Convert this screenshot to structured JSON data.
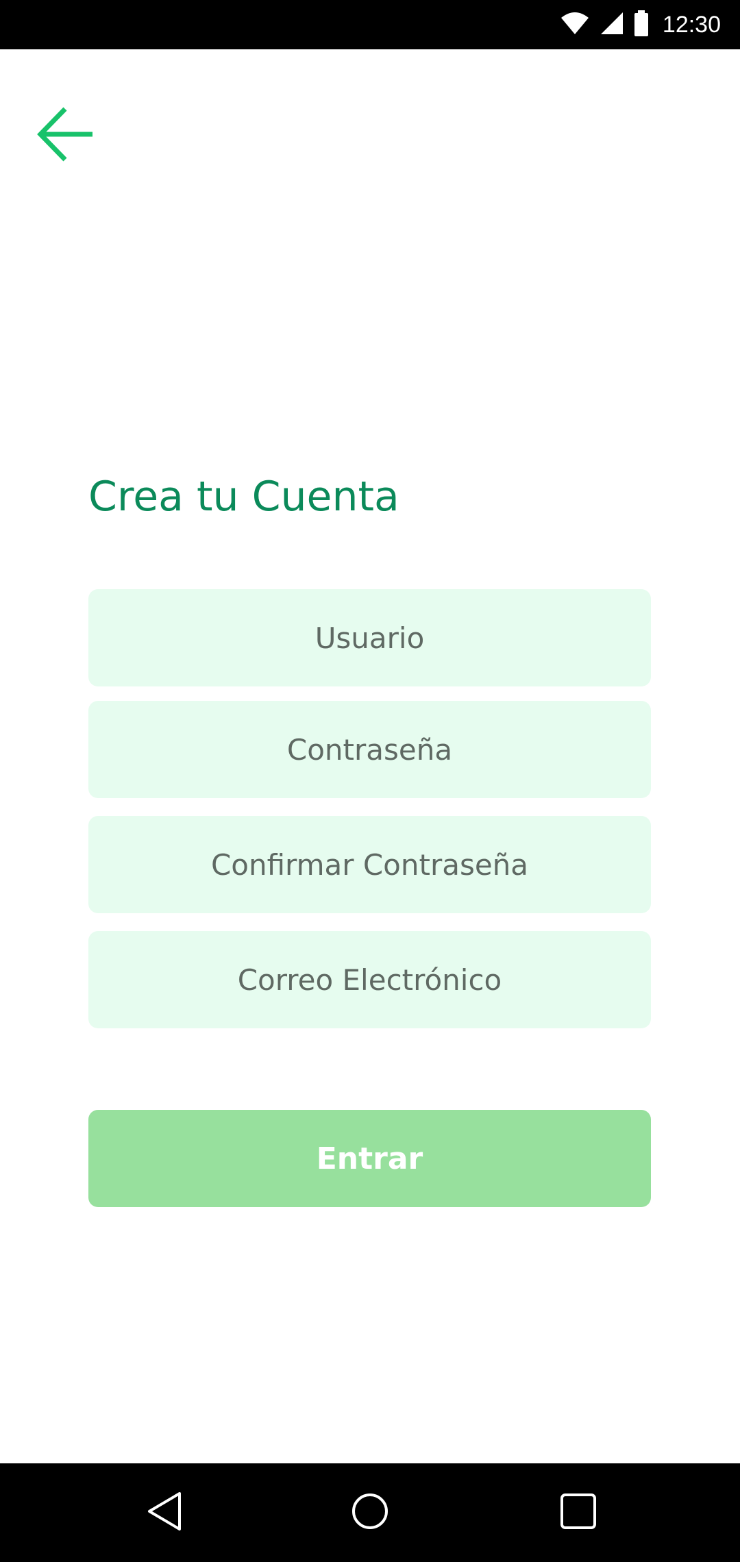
{
  "status_bar": {
    "time": "12:30",
    "icons": [
      "wifi-icon",
      "cellular-signal-icon",
      "battery-icon"
    ]
  },
  "header": {
    "back_icon": "arrow-left-icon",
    "accent_color": "#18c26a"
  },
  "form": {
    "title": "Crea tu Cuenta",
    "fields": [
      {
        "placeholder": "Usuario",
        "value": ""
      },
      {
        "placeholder": "Contraseña",
        "value": ""
      },
      {
        "placeholder": "Confirmar Contraseña",
        "value": ""
      },
      {
        "placeholder": "Correo Electrónico",
        "value": ""
      }
    ],
    "field_bg_color": "#e6fcef",
    "submit_label": "Entrar",
    "submit_color": "#97e09d"
  },
  "nav_bar": {
    "buttons": [
      "back-triangle-icon",
      "home-circle-icon",
      "recents-square-icon"
    ]
  }
}
